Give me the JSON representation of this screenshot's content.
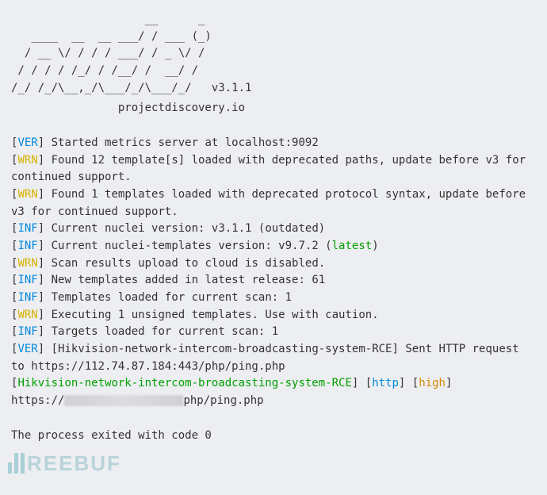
{
  "banner": "                    __      _\n   ____  __  __ ___/ / ___ (_)\n  / __ \\/ / / / ___/ / _ \\/ /\n / / / / /_/ / /__/ /  __/ /\n/_/ /_/\\__,_/\\___/_/\\___/_/   v3.1.1",
  "tagline": "                projectdiscovery.io",
  "lines": {
    "l0": {
      "tag": "VER",
      "cls": "ver",
      "text": "Started metrics server at localhost:9092"
    },
    "l1": {
      "tag": "WRN",
      "cls": "wrn",
      "text": "Found 12 template[s] loaded with deprecated paths, update before v3 for continued support."
    },
    "l2": {
      "tag": "WRN",
      "cls": "wrn",
      "text": "Found 1 templates loaded with deprecated protocol syntax, update before v3 for continued support."
    },
    "l3": {
      "tag": "INF",
      "cls": "inf",
      "text": "Current nuclei version: v3.1.1 (outdated)"
    },
    "l4": {
      "tag": "INF",
      "cls": "inf",
      "prefix": "Current nuclei-templates version: v9.7.2 (",
      "latest": "latest",
      "suffix": ")"
    },
    "l5": {
      "tag": "WRN",
      "cls": "wrn",
      "text": "Scan results upload to cloud is disabled."
    },
    "l6": {
      "tag": "INF",
      "cls": "inf",
      "text": "New templates added in latest release: 61"
    },
    "l7": {
      "tag": "INF",
      "cls": "inf",
      "text": "Templates loaded for current scan: 1"
    },
    "l8": {
      "tag": "WRN",
      "cls": "wrn",
      "text": "Executing 1 unsigned templates. Use with caution."
    },
    "l9": {
      "tag": "INF",
      "cls": "inf",
      "text": "Targets loaded for current scan: 1"
    },
    "l10": {
      "tag": "VER",
      "cls": "ver",
      "text": "[Hikvision-network-intercom-broadcasting-system-RCE] Sent HTTP request to https://112.74.87.184:443/php/ping.php"
    }
  },
  "result": {
    "template": "Hikvision-network-intercom-broadcasting-system-RCE",
    "protocol": "http",
    "severity": "high",
    "url_prefix": "https://",
    "url_suffix": "php/ping.php"
  },
  "exit": "The process exited with code 0",
  "watermark": "REEBUF"
}
